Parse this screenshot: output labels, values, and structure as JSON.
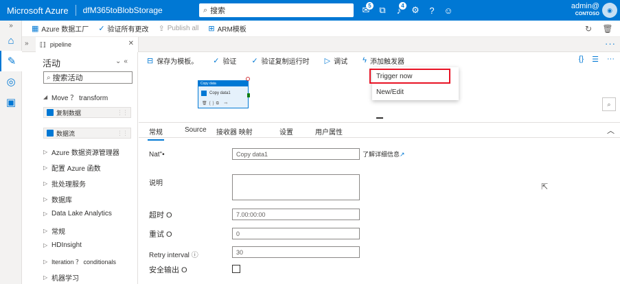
{
  "topbar": {
    "brand": "Microsoft Azure",
    "factory_name": "dfM365toBlobStorage",
    "search_placeholder": "搜索",
    "notifications_count": "5",
    "alerts_count": "4",
    "user": "admin@",
    "tenant": "CONTOSO",
    "colors": {
      "brand_blue": "#0078d4"
    }
  },
  "factory_toolbar": {
    "items": [
      {
        "label": "Azure 数据工厂",
        "icon": "factory-icon"
      },
      {
        "label": "验证所有更改",
        "icon": "check-icon"
      },
      {
        "label": "Publish all",
        "icon": "publish-icon",
        "disabled": true
      },
      {
        "label": "ARM模板",
        "icon": "arm-template-icon"
      }
    ]
  },
  "tab": {
    "label": "pipeline"
  },
  "activities": {
    "title": "活动",
    "search_placeholder": "搜索活动",
    "items": [
      {
        "label": "Move ？ transform",
        "expanded": true
      },
      {
        "label": "复制数据",
        "chip": true
      },
      {
        "label": "数据流",
        "chip": true
      },
      {
        "label": "Azure 数据资源管理器"
      },
      {
        "label": "配置 Azure 函数"
      },
      {
        "label": "批处理服务"
      },
      {
        "label": "数据库"
      },
      {
        "label": "Data Lake Analytics"
      },
      {
        "label": "常规"
      },
      {
        "label": "HDInsight"
      },
      {
        "label": "Iteration ？ conditionals"
      },
      {
        "label": "机器学习"
      }
    ]
  },
  "pipeline_toolbar": {
    "items": [
      {
        "label": "保存为模板。",
        "icon": "save-template-icon"
      },
      {
        "label": "验证",
        "icon": "check-icon"
      },
      {
        "label": "验证复制运行时",
        "icon": "check-icon"
      },
      {
        "label": "调试",
        "icon": "play-icon"
      },
      {
        "label": "添加触发器",
        "icon": "trigger-icon"
      }
    ]
  },
  "trigger_menu": {
    "items": [
      "Trigger now",
      "New/Edit"
    ]
  },
  "canvas": {
    "node": {
      "header": "Copy data",
      "name": "Copy data1"
    }
  },
  "properties": {
    "tabs": [
      "常规",
      "Source",
      "接收器 映射",
      "设置",
      "用户属性"
    ],
    "fields": {
      "name_label": "Nat\"•",
      "name_value": "Copy data1",
      "learn_more": "了解详细信息",
      "description_label": "说明",
      "timeout_label": "超时 O",
      "timeout_value": "7.00:00:00",
      "retry_label": "重试 O",
      "retry_value": "0",
      "retry_interval_label": "Retry interval",
      "retry_interval_value": "30",
      "secure_output_label": "安全输出 O"
    }
  }
}
